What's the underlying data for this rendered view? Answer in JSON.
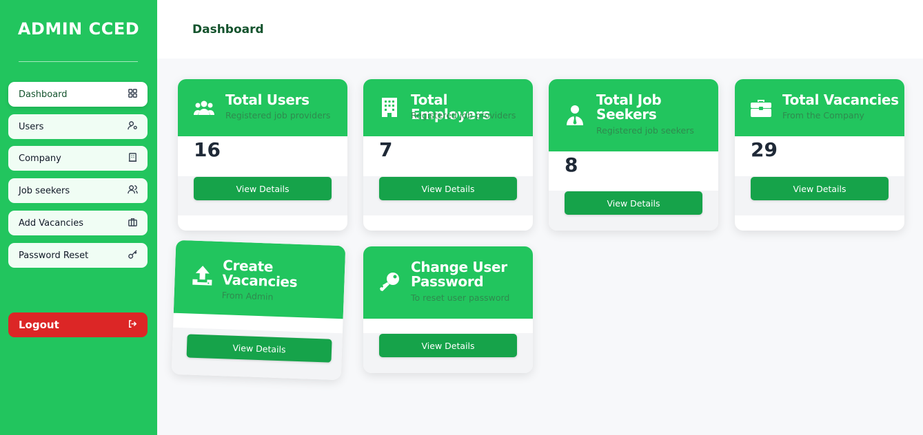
{
  "app": {
    "brand": "ADMIN CCED"
  },
  "header": {
    "title": "Dashboard"
  },
  "sidebar": {
    "items": [
      {
        "label": "Dashboard",
        "icon": "grid-icon"
      },
      {
        "label": "Users",
        "icon": "user-gear-icon"
      },
      {
        "label": "Company",
        "icon": "building-icon"
      },
      {
        "label": "Job seekers",
        "icon": "users-icon"
      },
      {
        "label": "Add Vacancies",
        "icon": "briefcase-icon"
      },
      {
        "label": "Password Reset",
        "icon": "key-icon"
      }
    ],
    "logout": {
      "label": "Logout",
      "icon": "logout-icon"
    }
  },
  "cards": [
    {
      "title": "Total Users",
      "subtitle": "Registered job providers",
      "count": "16",
      "button": "View Details",
      "icon": "users-group-icon"
    },
    {
      "title": "Total Employers",
      "subtitle": "Registered job providers",
      "count": "7",
      "button": "View Details",
      "icon": "building-icon"
    },
    {
      "title": "Total Job Seekers",
      "subtitle": "Registered job seekers",
      "count": "8",
      "button": "View Details",
      "icon": "person-tie-icon"
    },
    {
      "title": "Total Vacancies",
      "subtitle": "From the Company",
      "count": "29",
      "button": "View Details",
      "icon": "briefcase-icon"
    },
    {
      "title": "Create Vacancies",
      "subtitle": "From Admin",
      "button": "View Details",
      "icon": "upload-icon"
    },
    {
      "title": "Change User Password",
      "subtitle": "To reset user password",
      "button": "View Details",
      "icon": "key-icon"
    }
  ],
  "colors": {
    "primary": "#22c55e",
    "button": "#16a34a",
    "logout": "#dc2626",
    "title": "#14532d"
  }
}
